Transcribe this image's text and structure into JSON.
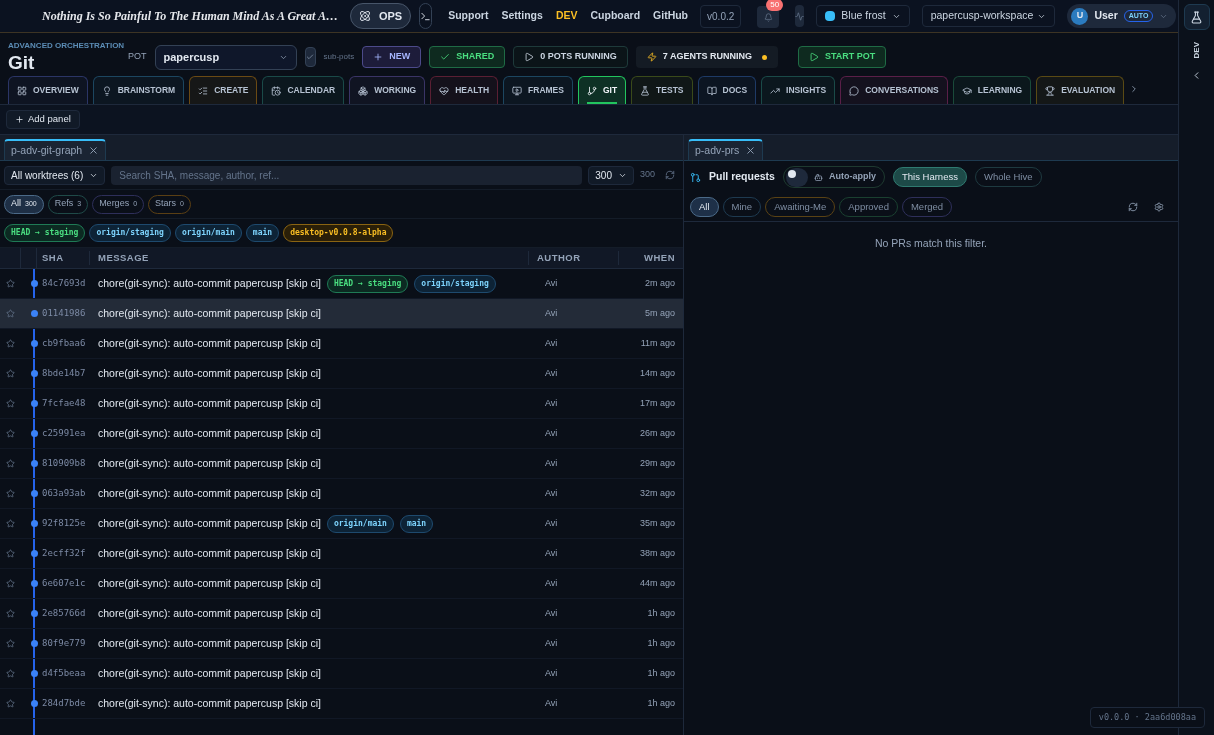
{
  "topbar": {
    "quote": "Nothing Is So Painful To The Human Mind As A Great A…",
    "mode_button": "OPS",
    "links": [
      {
        "label": "Support",
        "active": false
      },
      {
        "label": "Settings",
        "active": false
      },
      {
        "label": "DEV",
        "active": true
      },
      {
        "label": "Cupboard",
        "active": false
      },
      {
        "label": "GitHub",
        "active": false
      }
    ],
    "version": "v0.0.2",
    "notifications": "50",
    "theme": {
      "label": "Blue frost",
      "color": "#38bdf8"
    },
    "workspace": "papercusp-workspace",
    "user": {
      "initial": "U",
      "name": "User",
      "badge": "AUTO"
    }
  },
  "header": {
    "eyebrow": "ADVANCED ORCHESTRATION",
    "title": "Git",
    "pot_label": "POT",
    "pot": "papercusp",
    "sub_pots": {
      "label": "sub-pots",
      "checked": true
    },
    "buttons": [
      {
        "label": "NEW",
        "kind": "new"
      },
      {
        "label": "SHARED",
        "kind": "shared"
      },
      {
        "label": "0 POTS RUNNING",
        "kind": "status"
      },
      {
        "label": "7 AGENTS RUNNING",
        "kind": "agents"
      },
      {
        "label": "START POT",
        "kind": "start"
      }
    ]
  },
  "tabs": [
    {
      "label": "OVERVIEW",
      "color": "#2b3566",
      "selected": false
    },
    {
      "label": "BRAINSTORM",
      "color": "#1c4660",
      "selected": false
    },
    {
      "label": "CREATE",
      "color": "#6b4a14",
      "selected": false
    },
    {
      "label": "CALENDAR",
      "color": "#1a4a48",
      "selected": false
    },
    {
      "label": "WORKING",
      "color": "#3a3466",
      "selected": false
    },
    {
      "label": "HEALTH",
      "color": "#5a1f33",
      "selected": false
    },
    {
      "label": "FRAMES",
      "color": "#1c4660",
      "selected": false
    },
    {
      "label": "GIT",
      "color": "#22c55e",
      "selected": true
    },
    {
      "label": "TESTS",
      "color": "#3a4a1a",
      "selected": false
    },
    {
      "label": "DOCS",
      "color": "#1e3a66",
      "selected": false
    },
    {
      "label": "INSIGHTS",
      "color": "#1a4a48",
      "selected": false
    },
    {
      "label": "CONVERSATIONS",
      "color": "#5a1f48",
      "selected": false
    },
    {
      "label": "LEARNING",
      "color": "#1a4a3a",
      "selected": false
    },
    {
      "label": "EVALUATION",
      "color": "#5a4a14",
      "selected": false
    }
  ],
  "add_panel": "Add panel",
  "git_panel": {
    "tab": "p-adv-git-graph",
    "worktrees": "All worktrees (6)",
    "search_placeholder": "Search SHA, message, author, ref...",
    "limit": "300",
    "total": "300",
    "filters": [
      {
        "label": "All",
        "count": "300",
        "color": "#4b6a88",
        "selected": true
      },
      {
        "label": "Refs",
        "count": "3",
        "color": "#1f4a48",
        "selected": false
      },
      {
        "label": "Merges",
        "count": "0",
        "color": "#2e2f5a",
        "selected": false
      },
      {
        "label": "Stars",
        "count": "0",
        "color": "#5a3f14",
        "selected": false
      }
    ],
    "refs": [
      {
        "label": "HEAD → staging",
        "kind": "head"
      },
      {
        "label": "origin/staging",
        "kind": "remote"
      },
      {
        "label": "origin/main",
        "kind": "remote"
      },
      {
        "label": "main",
        "kind": "remote"
      },
      {
        "label": "desktop-v0.0.8-alpha",
        "kind": "tag"
      }
    ],
    "columns": [
      "SHA",
      "MESSAGE",
      "AUTHOR",
      "WHEN"
    ],
    "commits": [
      {
        "sha": "84c7693d",
        "message": "chore(git-sync): auto-commit papercusp [skip ci]",
        "author": "Avi",
        "when": "2m ago",
        "selected": false,
        "refs": [
          {
            "label": "HEAD → staging",
            "kind": "head"
          },
          {
            "label": "origin/staging",
            "kind": "remote"
          }
        ]
      },
      {
        "sha": "01141986",
        "message": "chore(git-sync): auto-commit papercusp [skip ci]",
        "author": "Avi",
        "when": "5m ago",
        "selected": true
      },
      {
        "sha": "cb9fbaa6",
        "message": "chore(git-sync): auto-commit papercusp [skip ci]",
        "author": "Avi",
        "when": "11m ago",
        "selected": false
      },
      {
        "sha": "8bde14b7",
        "message": "chore(git-sync): auto-commit papercusp [skip ci]",
        "author": "Avi",
        "when": "14m ago",
        "selected": false
      },
      {
        "sha": "7fcfae48",
        "message": "chore(git-sync): auto-commit papercusp [skip ci]",
        "author": "Avi",
        "when": "17m ago",
        "selected": false
      },
      {
        "sha": "c25991ea",
        "message": "chore(git-sync): auto-commit papercusp [skip ci]",
        "author": "Avi",
        "when": "26m ago",
        "selected": false
      },
      {
        "sha": "810909b8",
        "message": "chore(git-sync): auto-commit papercusp [skip ci]",
        "author": "Avi",
        "when": "29m ago",
        "selected": false
      },
      {
        "sha": "063a93ab",
        "message": "chore(git-sync): auto-commit papercusp [skip ci]",
        "author": "Avi",
        "when": "32m ago",
        "selected": false
      },
      {
        "sha": "92f8125e",
        "message": "chore(git-sync): auto-commit papercusp [skip ci]",
        "author": "Avi",
        "when": "35m ago",
        "selected": false,
        "refs": [
          {
            "label": "origin/main",
            "kind": "remote"
          },
          {
            "label": "main",
            "kind": "remote"
          }
        ]
      },
      {
        "sha": "2ecff32f",
        "message": "chore(git-sync): auto-commit papercusp [skip ci]",
        "author": "Avi",
        "when": "38m ago",
        "selected": false
      },
      {
        "sha": "6e607e1c",
        "message": "chore(git-sync): auto-commit papercusp [skip ci]",
        "author": "Avi",
        "when": "44m ago",
        "selected": false
      },
      {
        "sha": "2e85766d",
        "message": "chore(git-sync): auto-commit papercusp [skip ci]",
        "author": "Avi",
        "when": "1h ago",
        "selected": false
      },
      {
        "sha": "80f9e779",
        "message": "chore(git-sync): auto-commit papercusp [skip ci]",
        "author": "Avi",
        "when": "1h ago",
        "selected": false
      },
      {
        "sha": "d4f5beaa",
        "message": "chore(git-sync): auto-commit papercusp [skip ci]",
        "author": "Avi",
        "when": "1h ago",
        "selected": false
      },
      {
        "sha": "284d7bde",
        "message": "chore(git-sync): auto-commit papercusp [skip ci]",
        "author": "Avi",
        "when": "1h ago",
        "selected": false
      }
    ]
  },
  "pr_panel": {
    "tab": "p-adv-prs",
    "title": "Pull requests",
    "auto_apply": {
      "label": "Auto-apply",
      "on": false
    },
    "scopes": [
      {
        "label": "This Harness",
        "selected": true
      },
      {
        "label": "Whole Hive",
        "selected": false
      }
    ],
    "filters": [
      {
        "label": "All",
        "color": "#4b6a88",
        "selected": true
      },
      {
        "label": "Mine",
        "color": "#1e3a50",
        "selected": false
      },
      {
        "label": "Awaiting-Me",
        "color": "#5a4214",
        "selected": false
      },
      {
        "label": "Approved",
        "color": "#1a4030",
        "selected": false
      },
      {
        "label": "Merged",
        "color": "#2e2f5a",
        "selected": false
      }
    ],
    "empty": "No PRs match this filter."
  },
  "sidebar": {
    "label": "DEV"
  },
  "build": "v0.0.0 · 2aa6d008aa"
}
